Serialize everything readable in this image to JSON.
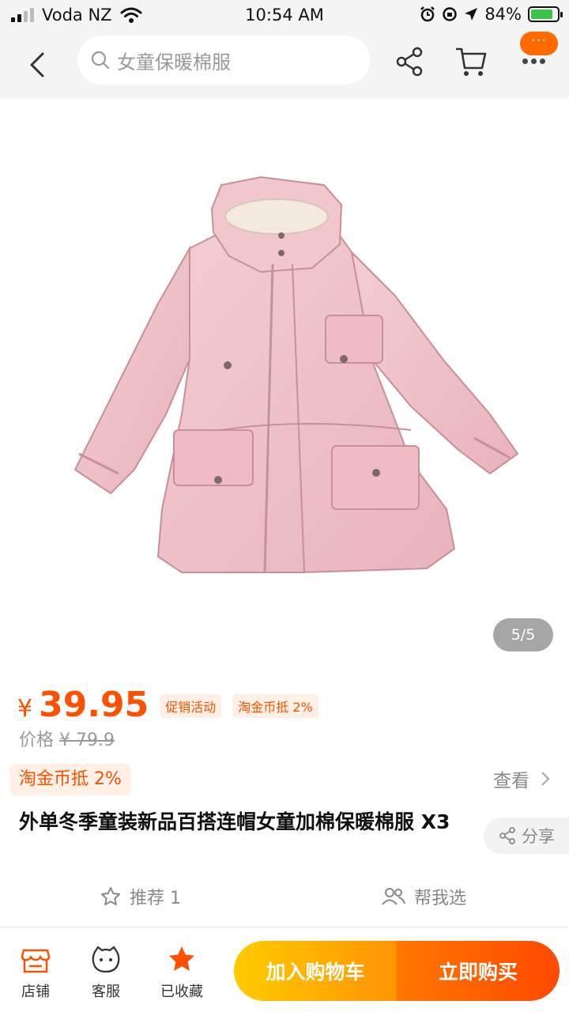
{
  "status_bar": {
    "carrier": "Voda NZ",
    "time": "10:54 AM",
    "battery": "84%"
  },
  "nav": {
    "search_placeholder": "女童保暖棉服",
    "more_badge": "···"
  },
  "gallery": {
    "page_indicator": "5/5"
  },
  "price": {
    "symbol": "¥",
    "value": "39.95",
    "tag_promo": "促销活动",
    "tag_coins": "淘金币抵 2%",
    "orig_label": "价格",
    "orig_value": "¥ 79.9"
  },
  "coupon": {
    "label": "淘金币抵 2%",
    "view": "查看"
  },
  "product": {
    "title": "外单冬季童装新品百搭连帽女童加棉保暖棉服 X3",
    "share": "分享"
  },
  "recommend": {
    "recommend_label": "推荐 1",
    "help_choose": "帮我选"
  },
  "bottom_bar": {
    "store": "店铺",
    "service": "客服",
    "favorited": "已收藏",
    "add_to_cart": "加入购物车",
    "buy_now": "立即购买"
  },
  "colors": {
    "accent": "#ff5000",
    "coat": "#f0c4ca"
  }
}
